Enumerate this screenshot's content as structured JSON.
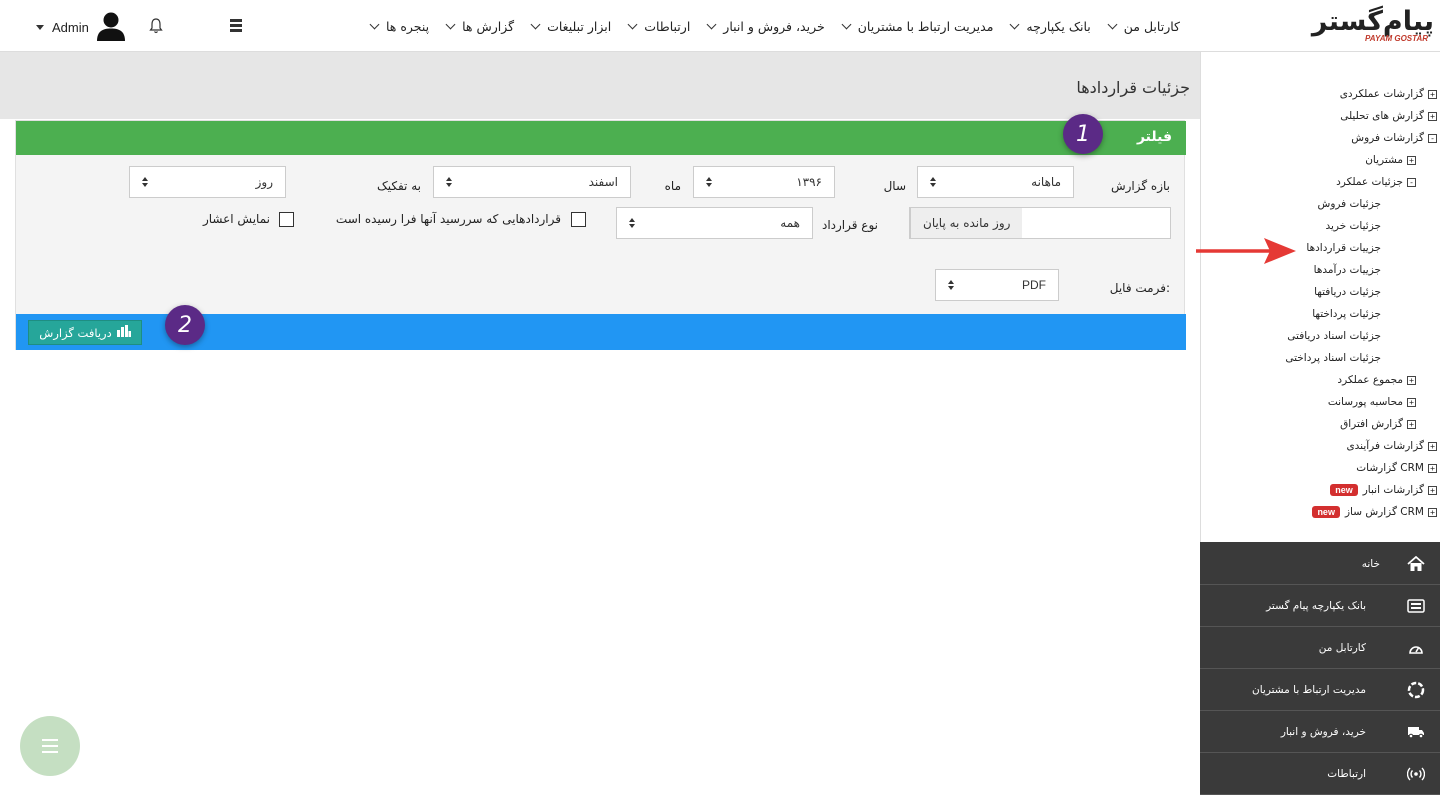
{
  "logo": {
    "main": "پیام‌گستر",
    "sub": "PAYAM GOSTAR"
  },
  "nav": {
    "items": [
      "کارتابل من",
      "بانک یکپارچه",
      "مدیریت ارتباط با مشتریان",
      "خرید، فروش و انبار",
      "ارتباطات",
      "ابزار تبلیغات",
      "گزارش ها",
      "پنجره ها"
    ],
    "user_name": "Admin"
  },
  "page": {
    "title": "جزئیات قراردادها"
  },
  "filter": {
    "title": "فیلتر",
    "period_label": "بازه گزارش",
    "period_value": "ماهانه",
    "year_label": "سال",
    "year_value": "۱۳۹۶",
    "month_label": "ماه",
    "month_value": "اسفند",
    "breakdown_label": "به تفکیک",
    "breakdown_value": "روز",
    "days_left_addon": "روز مانده به پایان",
    "days_left_value": "",
    "contract_type_label": "نوع قرارداد",
    "contract_type_value": "همه",
    "due_contracts_label": "قراردادهایی که سررسید آنها فرا رسیده است",
    "show_decimal_label": "نمایش اعشار",
    "file_format_label": "فرمت فایل:",
    "file_format_value": "PDF",
    "get_report_button": "دریافت گزارش"
  },
  "badges": {
    "one": "1",
    "two": "2"
  },
  "tree": [
    {
      "label": "گزارشات عملکردی",
      "state": "+"
    },
    {
      "label": "گزارش های تحلیلی",
      "state": "+"
    },
    {
      "label": "گزارشات فروش",
      "state": "-"
    },
    {
      "label": "مشتریان",
      "state": "+"
    },
    {
      "label": "جزئیات عملکرد",
      "state": "-"
    },
    {
      "label": "جزئیات فروش",
      "state": ""
    },
    {
      "label": "جزئیات خرید",
      "state": ""
    },
    {
      "label": "جزییات قراردادها",
      "state": ""
    },
    {
      "label": "جزییات درآمدها",
      "state": ""
    },
    {
      "label": "جزئیات دریافتها",
      "state": ""
    },
    {
      "label": "جزئیات پرداختها",
      "state": ""
    },
    {
      "label": "جزئیات اسناد دریافتی",
      "state": ""
    },
    {
      "label": "جزئیات اسناد پرداختی",
      "state": ""
    },
    {
      "label": "مجموع عملکرد",
      "state": "+"
    },
    {
      "label": "محاسبه پورسانت",
      "state": "+"
    },
    {
      "label": "گزارش افتراق",
      "state": "+"
    },
    {
      "label": "گزارشات فرآیندی",
      "state": "+"
    },
    {
      "label": "گزارشات CRM",
      "state": "+"
    },
    {
      "label": "گزارشات انبار",
      "state": "+",
      "badge": "new"
    },
    {
      "label": "گزارش ساز CRM",
      "state": "+",
      "badge": "new"
    }
  ],
  "side_menu": [
    {
      "label": "خانه",
      "icon": "home-icon"
    },
    {
      "label": "بانک یکپارچه پیام گستر",
      "icon": "archive-icon"
    },
    {
      "label": "کارتابل من",
      "icon": "dashboard-icon"
    },
    {
      "label": "مدیریت ارتباط با مشتریان",
      "icon": "lifebuoy-icon"
    },
    {
      "label": "خرید، فروش و انبار",
      "icon": "truck-icon"
    },
    {
      "label": "ارتباطات",
      "icon": "broadcast-icon"
    }
  ],
  "colors": {
    "filter_bar": "#4caf50",
    "action_bar": "#2196f3",
    "button": "#26a69a",
    "badge": "#5b2a86",
    "sidebar_dark": "#3a3a3a",
    "new_badge": "#d32f2f",
    "arrow": "#e53935"
  }
}
